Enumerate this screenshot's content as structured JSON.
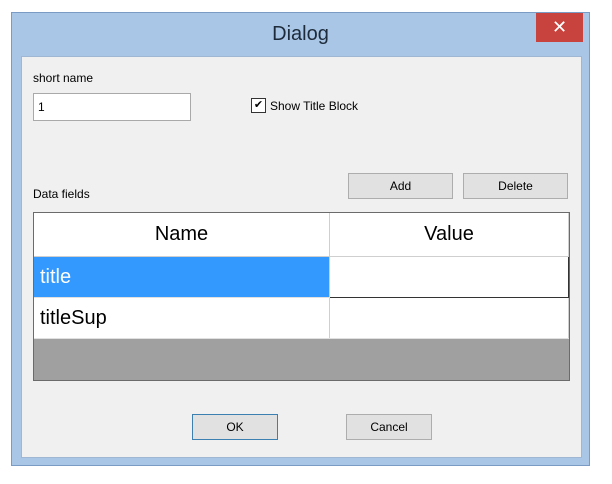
{
  "window": {
    "title": "Dialog",
    "close_glyph": "✕"
  },
  "form": {
    "short_name_label": "short name",
    "short_name_value": "1",
    "show_title_block_label": "Show Title Block",
    "show_title_block_checked": true,
    "checkmark_glyph": "✔",
    "data_fields_label": "Data fields"
  },
  "buttons": {
    "add_label": "Add",
    "delete_label": "Delete",
    "ok_label": "OK",
    "cancel_label": "Cancel"
  },
  "table": {
    "columns": [
      "Name",
      "Value"
    ],
    "rows": [
      {
        "name": "title",
        "value": ""
      },
      {
        "name": "titleSup",
        "value": ""
      }
    ]
  },
  "colors": {
    "window_frame": "#a9c6e6",
    "close_button": "#c9433e",
    "selection": "#3399ff",
    "grid_empty_area": "#a0a0a0"
  }
}
